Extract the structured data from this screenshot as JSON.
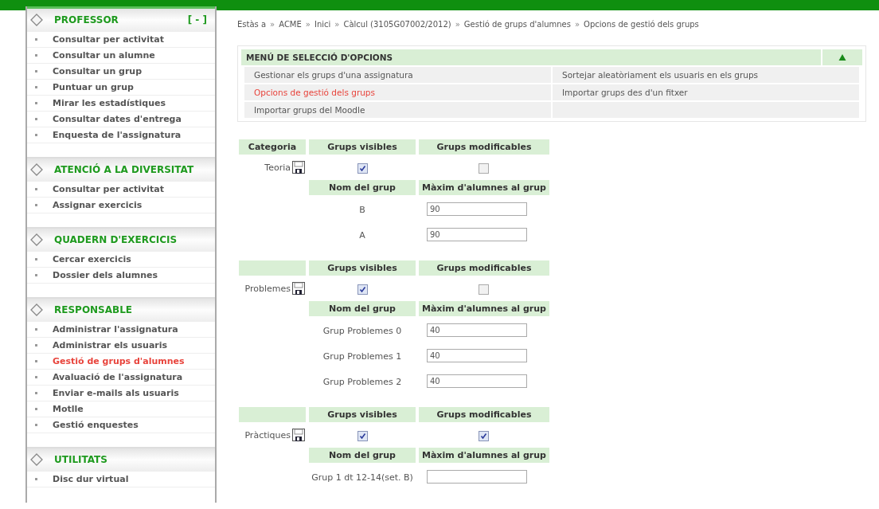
{
  "sidebar": {
    "sections": [
      {
        "title": "PROFESSOR",
        "toggle": "[ - ]",
        "items": [
          {
            "label": "Consultar per activitat",
            "selected": false
          },
          {
            "label": "Consultar un alumne",
            "selected": false
          },
          {
            "label": "Consultar un grup",
            "selected": false
          },
          {
            "label": "Puntuar un grup",
            "selected": false
          },
          {
            "label": "Mirar les estadístiques",
            "selected": false
          },
          {
            "label": "Consultar dates d'entrega",
            "selected": false
          },
          {
            "label": "Enquesta de l'assignatura",
            "selected": false
          }
        ]
      },
      {
        "title": "ATENCIÓ A LA DIVERSITAT",
        "items": [
          {
            "label": "Consultar per activitat",
            "selected": false
          },
          {
            "label": "Assignar exercicis",
            "selected": false
          }
        ]
      },
      {
        "title": "QUADERN D'EXERCICIS",
        "items": [
          {
            "label": "Cercar exercicis",
            "selected": false
          },
          {
            "label": "Dossier dels alumnes",
            "selected": false
          }
        ]
      },
      {
        "title": "RESPONSABLE",
        "items": [
          {
            "label": "Administrar l'assignatura",
            "selected": false
          },
          {
            "label": "Administrar els usuaris",
            "selected": false
          },
          {
            "label": "Gestió de grups d'alumnes",
            "selected": true
          },
          {
            "label": "Avaluació de l'assignatura",
            "selected": false
          },
          {
            "label": "Enviar e-mails als usuaris",
            "selected": false
          },
          {
            "label": "Motlle",
            "selected": false
          },
          {
            "label": "Gestió enquestes",
            "selected": false
          }
        ]
      },
      {
        "title": "UTILITATS",
        "items": [
          {
            "label": "Disc dur virtual",
            "selected": false
          }
        ]
      }
    ]
  },
  "breadcrumb": [
    {
      "label": "Estàs a"
    },
    {
      "separator": "»",
      "label": "ACME"
    },
    {
      "separator": "»",
      "label": "Inici"
    },
    {
      "separator": "»",
      "label": "Càlcul (3105G07002/2012)"
    },
    {
      "separator": "»",
      "label": "Gestió de grups d'alumnes"
    },
    {
      "separator": "»",
      "label": "Opcions de gestió dels grups"
    }
  ],
  "options_menu": {
    "title": "MENÚ DE SELECCIÓ D'OPCIONS",
    "items": [
      {
        "label": "Gestionar els grups d'una assignatura",
        "selected": false
      },
      {
        "label": "Sortejar aleatòriament els usuaris en els grups",
        "selected": false
      },
      {
        "label": "Opcions de gestió dels grups",
        "selected": true
      },
      {
        "label": "Importar grups des d'un fitxer",
        "selected": false
      },
      {
        "label": "Importar grups del Moodle",
        "selected": false
      }
    ]
  },
  "categories": [
    {
      "header": "Categoria",
      "name": "Teoria",
      "visible_header": "Grups visibles",
      "modifiable_header": "Grups modificables",
      "visible": true,
      "modifiable": false,
      "group_header": "Nom del grup",
      "max_header": "Màxim d'alumnes al grup",
      "groups": [
        {
          "name": "B",
          "max": "90"
        },
        {
          "name": "A",
          "max": "90"
        }
      ]
    },
    {
      "name": "Problemes",
      "visible_header": "Grups visibles",
      "modifiable_header": "Grups modificables",
      "visible": true,
      "modifiable": false,
      "group_header": "Nom del grup",
      "max_header": "Màxim d'alumnes al grup",
      "groups": [
        {
          "name": "Grup Problemes 0",
          "max": "40"
        },
        {
          "name": "Grup Problemes 1",
          "max": "40"
        },
        {
          "name": "Grup Problemes 2",
          "max": "40"
        }
      ]
    },
    {
      "name": "Pràctiques",
      "visible_header": "Grups visibles",
      "modifiable_header": "Grups modificables",
      "visible": true,
      "modifiable": true,
      "group_header": "Nom del grup",
      "max_header": "Màxim d'alumnes al grup",
      "groups": [
        {
          "name": "Grup 1 dt 12-14(set. B)"
        }
      ]
    }
  ]
}
